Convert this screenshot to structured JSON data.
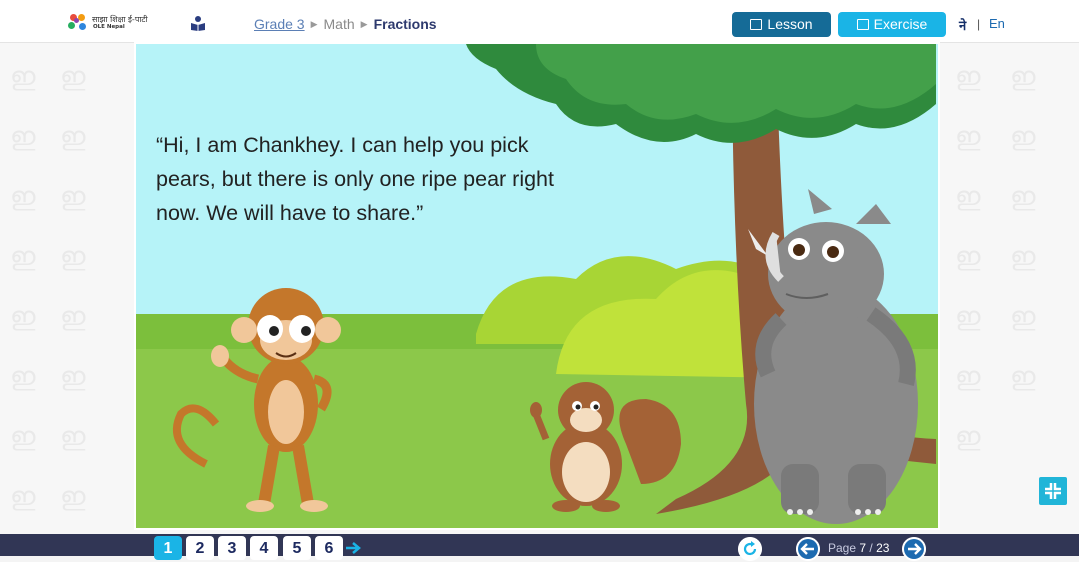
{
  "header": {
    "logo_text_line1": "साझा शिक्षा ई-पाटी",
    "logo_text_line2": "OLE Nepal",
    "breadcrumb": {
      "grade": "Grade 3",
      "subject": "Math",
      "current": "Fractions"
    },
    "lesson_label": "Lesson",
    "exercise_label": "Exercise",
    "lang_ne": "ने",
    "lang_sep": "|",
    "lang_en": "En"
  },
  "story": {
    "text": "“Hi, I am Chankhey. I can help you pick pears, but there is only one ripe pear right now. We will have to share.”"
  },
  "footer": {
    "pages": [
      "1",
      "2",
      "3",
      "4",
      "5",
      "6"
    ],
    "active_page": "1",
    "page_prefix": "Page",
    "current_page": "7",
    "page_sep": "/",
    "total_pages": "23"
  },
  "icons": {
    "reader": "reader-icon",
    "next_pages": "arrow-right-icon",
    "refresh": "refresh-icon",
    "prev": "prev-page-icon",
    "next": "next-page-icon",
    "expand": "expand-icon"
  },
  "colors": {
    "lesson_button": "#156b97",
    "exercise_button": "#1ab4e6",
    "footer": "#313655",
    "sky": "#b6f3f8",
    "grass": "#85c444"
  }
}
